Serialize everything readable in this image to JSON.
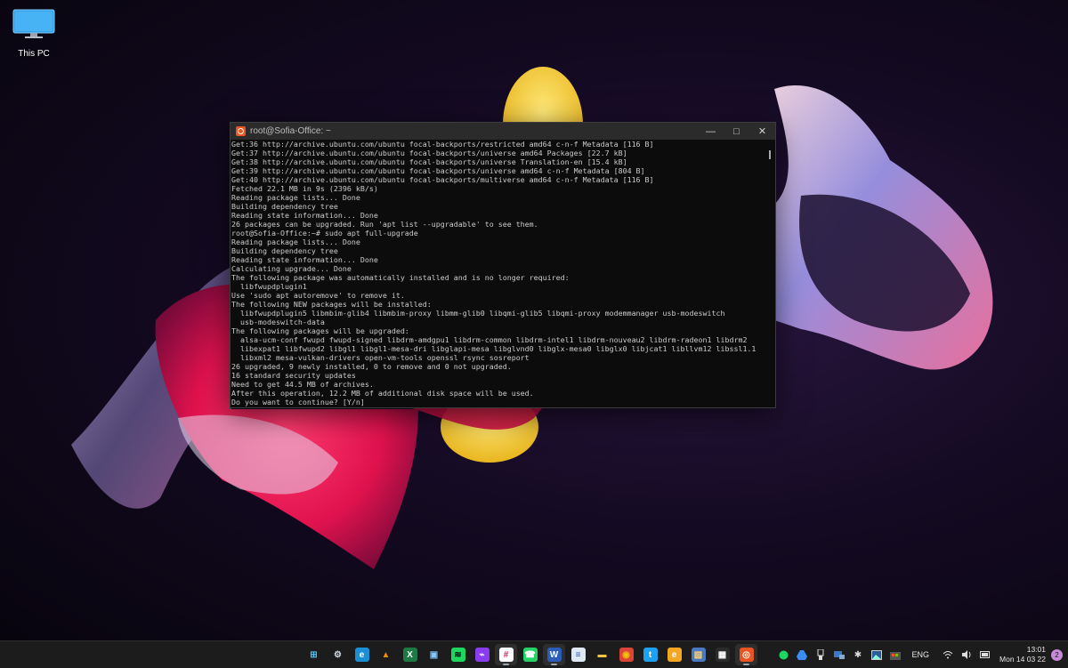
{
  "desktop": {
    "icons": [
      {
        "label": "This PC",
        "icon": "monitor-icon"
      }
    ]
  },
  "terminal": {
    "title": "root@Sofia-Office: ~",
    "lines": [
      "Get:36 http://archive.ubuntu.com/ubuntu focal-backports/restricted amd64 c-n-f Metadata [116 B]",
      "Get:37 http://archive.ubuntu.com/ubuntu focal-backports/universe amd64 Packages [22.7 kB]",
      "Get:38 http://archive.ubuntu.com/ubuntu focal-backports/universe Translation-en [15.4 kB]",
      "Get:39 http://archive.ubuntu.com/ubuntu focal-backports/universe amd64 c-n-f Metadata [804 B]",
      "Get:40 http://archive.ubuntu.com/ubuntu focal-backports/multiverse amd64 c-n-f Metadata [116 B]",
      "Fetched 22.1 MB in 9s (2396 kB/s)",
      "Reading package lists... Done",
      "Building dependency tree",
      "Reading state information... Done",
      "26 packages can be upgraded. Run 'apt list --upgradable' to see them.",
      "root@Sofia-Office:~# sudo apt full-upgrade",
      "Reading package lists... Done",
      "Building dependency tree",
      "Reading state information... Done",
      "Calculating upgrade... Done",
      "The following package was automatically installed and is no longer required:",
      "  libfwupdplugin1",
      "Use 'sudo apt autoremove' to remove it.",
      "The following NEW packages will be installed:",
      "  libfwupdplugin5 libmbim-glib4 libmbim-proxy libmm-glib0 libqmi-glib5 libqmi-proxy modemmanager usb-modeswitch",
      "  usb-modeswitch-data",
      "The following packages will be upgraded:",
      "  alsa-ucm-conf fwupd fwupd-signed libdrm-amdgpu1 libdrm-common libdrm-intel1 libdrm-nouveau2 libdrm-radeon1 libdrm2",
      "  libexpat1 libfwupd2 libgl1 libgl1-mesa-dri libglapi-mesa libglvnd0 libglx-mesa0 libglx0 libjcat1 libllvm12 libssl1.1",
      "  libxml2 mesa-vulkan-drivers open-vm-tools openssl rsync sosreport",
      "26 upgraded, 9 newly installed, 0 to remove and 0 not upgraded.",
      "16 standard security updates",
      "Need to get 44.5 MB of archives.",
      "After this operation, 12.2 MB of additional disk space will be used.",
      "Do you want to continue? [Y/n]"
    ]
  },
  "taskbar": {
    "apps": [
      {
        "name": "start",
        "glyph": "⊞",
        "color": "#4cc2ff",
        "bg": "transparent"
      },
      {
        "name": "settings",
        "glyph": "⚙",
        "color": "#cfd8e0",
        "bg": "transparent"
      },
      {
        "name": "edge",
        "glyph": "e",
        "color": "#ffffff",
        "bg": "#1a8fd6"
      },
      {
        "name": "vlc",
        "glyph": "▲",
        "color": "#f08a0a",
        "bg": "transparent"
      },
      {
        "name": "excel",
        "glyph": "X",
        "color": "#ffffff",
        "bg": "#1d7a45"
      },
      {
        "name": "office",
        "glyph": "▣",
        "color": "#7fc8ff",
        "bg": "transparent"
      },
      {
        "name": "spotify",
        "glyph": "≋",
        "color": "#0b0b0b",
        "bg": "#1ed760"
      },
      {
        "name": "messenger",
        "glyph": "⌁",
        "color": "#ffffff",
        "bg": "#8a3cf0"
      },
      {
        "name": "slack",
        "glyph": "#",
        "color": "#e01e5a",
        "bg": "#ffffff"
      },
      {
        "name": "whatsapp",
        "glyph": "☎",
        "color": "#ffffff",
        "bg": "#25d366"
      },
      {
        "name": "word",
        "glyph": "W",
        "color": "#ffffff",
        "bg": "#2b5cb8"
      },
      {
        "name": "notepad",
        "glyph": "≡",
        "color": "#2b5cb8",
        "bg": "#dfe9f5"
      },
      {
        "name": "file-explorer",
        "glyph": "▬",
        "color": "#f6c445",
        "bg": "transparent"
      },
      {
        "name": "chrome",
        "glyph": "◉",
        "color": "#f4c20d",
        "bg": "#db4437"
      },
      {
        "name": "twitter",
        "glyph": "t",
        "color": "#ffffff",
        "bg": "#1da1f2"
      },
      {
        "name": "ebay",
        "glyph": "e",
        "color": "#ffffff",
        "bg": "#f5a623"
      },
      {
        "name": "photos",
        "glyph": "▧",
        "color": "#ffd56b",
        "bg": "#4a78c2"
      },
      {
        "name": "store",
        "glyph": "▦",
        "color": "#ffffff",
        "bg": "#2a2a2a"
      },
      {
        "name": "ubuntu",
        "glyph": "◎",
        "color": "#ffffff",
        "bg": "#e95420"
      }
    ],
    "active_apps": [
      "slack",
      "word",
      "ubuntu"
    ],
    "tray": {
      "language": "ENG",
      "time": "13:01",
      "date": "Mon 14 03 22",
      "notification_count": "2"
    }
  }
}
